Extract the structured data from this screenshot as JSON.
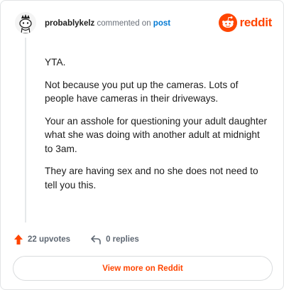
{
  "header": {
    "username": "probablykelz",
    "action_text": "commented on",
    "post_link": "post",
    "brand_name": "reddit",
    "avatar_icon": "snoo-avatar-icon",
    "brand_icon": "reddit-snoo-icon"
  },
  "comment": {
    "paragraphs": [
      "YTA.",
      "Not because you put up the cameras. Lots of people have cameras in their driveways.",
      "Your an asshole for questioning your adult daughter what she was doing with another adult at midnight to 3am.",
      "They are having sex and no she does not need to tell you this."
    ]
  },
  "footer": {
    "upvotes": "22 upvotes",
    "replies": "0 replies",
    "upvote_icon": "upvote-arrow-icon",
    "reply_icon": "reply-arrow-icon"
  },
  "cta": {
    "label": "View more on Reddit"
  },
  "colors": {
    "brand": "#ff4500",
    "link": "#0079d3",
    "muted": "#5f6873"
  }
}
